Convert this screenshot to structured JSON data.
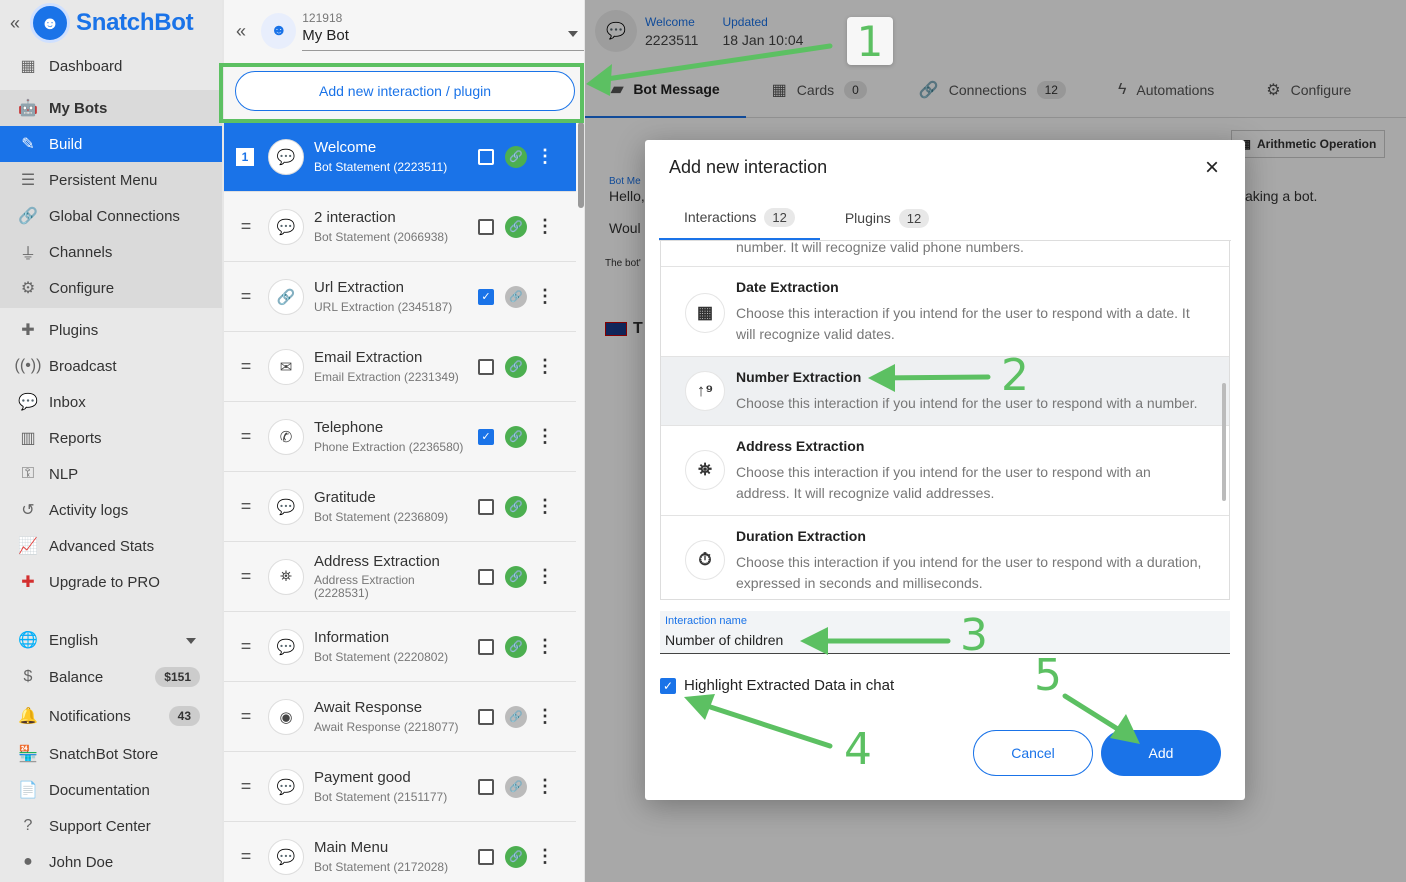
{
  "sidebar": {
    "collapse": "«",
    "logo": "SnatchBot",
    "items": [
      {
        "label": "Dashboard",
        "icon": "dashboard-icon"
      },
      {
        "label": "My Bots",
        "icon": "robot-icon"
      },
      {
        "label": "Build",
        "icon": "edit-icon"
      },
      {
        "label": "Persistent Menu",
        "icon": "menu-icon"
      },
      {
        "label": "Global Connections",
        "icon": "link-icon"
      },
      {
        "label": "Channels",
        "icon": "plug-icon"
      },
      {
        "label": "Configure",
        "icon": "gear-icon"
      },
      {
        "label": "Plugins",
        "icon": "puzzle-icon"
      },
      {
        "label": "Broadcast",
        "icon": "broadcast-icon"
      },
      {
        "label": "Inbox",
        "icon": "chat-icon"
      },
      {
        "label": "Reports",
        "icon": "bar-chart-icon"
      },
      {
        "label": "NLP",
        "icon": "nlp-icon"
      },
      {
        "label": "Activity logs",
        "icon": "history-icon"
      },
      {
        "label": "Advanced Stats",
        "icon": "line-chart-icon"
      },
      {
        "label": "Upgrade to PRO",
        "icon": "plus-badge-icon"
      },
      {
        "label": "English",
        "icon": "globe-icon"
      },
      {
        "label": "Balance",
        "icon": "dollar-icon",
        "badge": "$151"
      },
      {
        "label": "Notifications",
        "icon": "bell-icon",
        "badge": "43"
      },
      {
        "label": "SnatchBot Store",
        "icon": "store-icon"
      },
      {
        "label": "Documentation",
        "icon": "document-icon"
      },
      {
        "label": "Support Center",
        "icon": "help-icon"
      },
      {
        "label": "John Doe",
        "icon": "user-icon"
      }
    ]
  },
  "panel": {
    "collapse": "«",
    "bot_id": "121918",
    "bot_name": "My Bot",
    "add_label": "Add new interaction / plugin",
    "interactions": [
      {
        "num": "1",
        "title": "Welcome",
        "sub": "Bot Statement (2223511)",
        "icon": "speech-bubble-icon",
        "checked": false,
        "linked": true
      },
      {
        "title": "2 interaction",
        "sub": "Bot Statement (2066938)",
        "icon": "speech-bubble-icon",
        "checked": false,
        "linked": true
      },
      {
        "title": "Url Extraction",
        "sub": "URL Extraction (2345187)",
        "icon": "link-icon",
        "checked": true,
        "linked": false
      },
      {
        "title": "Email Extraction",
        "sub": "Email Extraction (2231349)",
        "icon": "envelope-icon",
        "checked": false,
        "linked": true
      },
      {
        "title": "Telephone",
        "sub": "Phone Extraction (2236580)",
        "icon": "phone-icon",
        "checked": true,
        "linked": true
      },
      {
        "title": "Gratitude",
        "sub": "Bot Statement (2236809)",
        "icon": "speech-bubble-icon",
        "checked": false,
        "linked": true
      },
      {
        "title": "Address Extraction",
        "sub": "Address Extraction (2228531)",
        "icon": "map-icon",
        "checked": false,
        "linked": true
      },
      {
        "title": "Information",
        "sub": "Bot Statement (2220802)",
        "icon": "speech-bubble-icon",
        "checked": false,
        "linked": true
      },
      {
        "title": "Await Response",
        "sub": "Await Response (2218077)",
        "icon": "user-circle-icon",
        "checked": false,
        "linked": false
      },
      {
        "title": "Payment good",
        "sub": "Bot Statement (2151177)",
        "icon": "speech-bubble-icon",
        "checked": false,
        "linked": false
      },
      {
        "title": "Main Menu",
        "sub": "Bot Statement (2172028)",
        "icon": "speech-bubble-icon",
        "checked": false,
        "linked": true
      }
    ]
  },
  "main": {
    "meta": [
      {
        "label": "Welcome",
        "value": "2223511"
      },
      {
        "label": "Updated",
        "value": "18 Jan 10:04"
      }
    ],
    "tabs": [
      {
        "label": "Bot Message",
        "icon": "message-icon"
      },
      {
        "label": "Cards",
        "badge": "0",
        "icon": "grid-icon"
      },
      {
        "label": "Connections",
        "badge": "12",
        "icon": "link-icon"
      },
      {
        "label": "Automations",
        "icon": "bolt-icon"
      },
      {
        "label": "Configure",
        "icon": "gear-icon"
      }
    ],
    "arith_label": "Arithmetic Operation",
    "bg_bot_label": "Bot Me",
    "bg_hello": "Hello,",
    "bg_would": "Woul",
    "bg_making": "aking a bot.",
    "bg_note": "The bot'",
    "bg_t": "T"
  },
  "modal": {
    "title": "Add new interaction",
    "close": "×",
    "tabs": [
      {
        "label": "Interactions",
        "badge": "12"
      },
      {
        "label": "Plugins",
        "badge": "12"
      }
    ],
    "partial_text": "number. It will recognize valid phone numbers.",
    "options": [
      {
        "title": "Date Extraction",
        "desc": "Choose this interaction if you intend for the user to respond with a date. It will recognize valid dates.",
        "icon": "calendar-icon"
      },
      {
        "title": "Number Extraction",
        "desc": "Choose this interaction if you intend for the user to respond with a number.",
        "icon": "number-sort-icon"
      },
      {
        "title": "Address Extraction",
        "desc": "Choose this interaction if you intend for the user to respond with an address. It will recognize valid addresses.",
        "icon": "map-marker-icon"
      },
      {
        "title": "Duration Extraction",
        "desc": "Choose this interaction if you intend for the user to respond with a duration, expressed in seconds and milliseconds.",
        "icon": "stopwatch-icon"
      }
    ],
    "name_label": "Interaction name",
    "name_value": "Number of children",
    "highlight_label": "Highlight Extracted Data in chat",
    "cancel": "Cancel",
    "add": "Add"
  },
  "annotations": {
    "n1": "1",
    "n2": "2",
    "n3": "3",
    "n4": "4",
    "n5": "5",
    "color": "#5cc062"
  },
  "colors": {
    "accent": "#1a73e8",
    "success": "#4caf50"
  }
}
